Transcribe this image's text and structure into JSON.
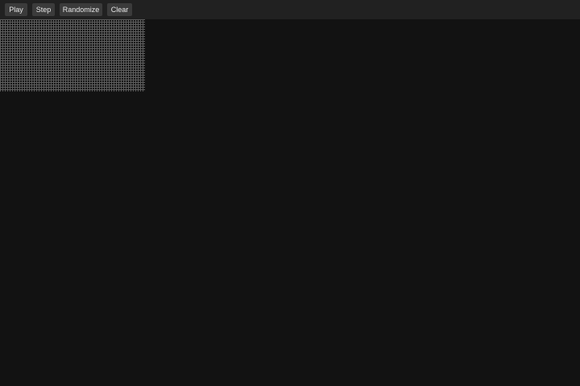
{
  "toolbar": {
    "buttons": {
      "play": "Play",
      "step": "Step",
      "randomize": "Randomize",
      "clear": "Clear"
    }
  },
  "colors": {
    "background": "#121212",
    "toolbar": "#212121",
    "button": "#3b3b3b",
    "button_text": "#e6e6e6",
    "grid_line": "#5c5c5c"
  }
}
